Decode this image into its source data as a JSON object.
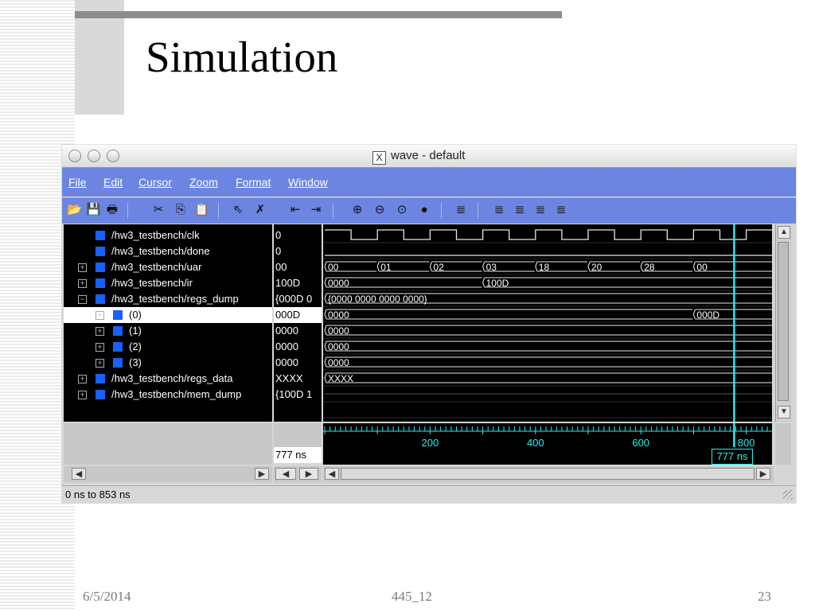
{
  "slide": {
    "title": "Simulation",
    "footer_date": "6/5/2014",
    "footer_course": "445_12",
    "footer_page": "23"
  },
  "window": {
    "title": "wave - default",
    "menu": [
      "File",
      "Edit",
      "Cursor",
      "Zoom",
      "Format",
      "Window"
    ],
    "toolbar_icons": [
      "open-icon",
      "save-icon",
      "print-icon",
      "cut-icon",
      "copy-icon",
      "paste-icon",
      "select-pointer-icon",
      "delete-icon",
      "find-previous-icon",
      "find-next-icon",
      "zoom-in-icon",
      "zoom-out-icon",
      "zoom-full-icon",
      "zoom-area-icon",
      "insert-cursor-icon",
      "insert-marker-icon",
      "edit-marker-icon",
      "next-edge-icon",
      "delete-cursor-icon"
    ]
  },
  "signals": [
    {
      "name": "/hw3_testbench/clk",
      "value": "0",
      "expandable": false,
      "indent": 0
    },
    {
      "name": "/hw3_testbench/done",
      "value": "0",
      "expandable": false,
      "indent": 0
    },
    {
      "name": "/hw3_testbench/uar",
      "value": "00",
      "expandable": true,
      "indent": 0
    },
    {
      "name": "/hw3_testbench/ir",
      "value": "100D",
      "expandable": true,
      "indent": 0
    },
    {
      "name": "/hw3_testbench/regs_dump",
      "value": "{000D 0",
      "expandable": true,
      "expanded": true,
      "indent": 0
    },
    {
      "name": "(0)",
      "value": "000D",
      "expandable": true,
      "indent": 1,
      "selected": true
    },
    {
      "name": "(1)",
      "value": "0000",
      "expandable": true,
      "indent": 1
    },
    {
      "name": "(2)",
      "value": "0000",
      "expandable": true,
      "indent": 1
    },
    {
      "name": "(3)",
      "value": "0000",
      "expandable": true,
      "indent": 1
    },
    {
      "name": "/hw3_testbench/regs_data",
      "value": "XXXX",
      "expandable": true,
      "indent": 0
    },
    {
      "name": "/hw3_testbench/mem_dump",
      "value": "{100D 1",
      "expandable": true,
      "indent": 0
    }
  ],
  "waveform": {
    "time_end_ns": 853,
    "clk_half_period_ns": 50,
    "uar_values": [
      {
        "t": 0,
        "v": "00"
      },
      {
        "t": 100,
        "v": "01"
      },
      {
        "t": 200,
        "v": "02"
      },
      {
        "t": 300,
        "v": "03"
      },
      {
        "t": 400,
        "v": "18"
      },
      {
        "t": 500,
        "v": "20"
      },
      {
        "t": 600,
        "v": "28"
      },
      {
        "t": 700,
        "v": "00"
      }
    ],
    "ir_values": [
      {
        "t": 0,
        "v": "0000"
      },
      {
        "t": 300,
        "v": "100D"
      }
    ],
    "regs_dump_label": "{0000 0000 0000 0000}",
    "reg0_values": [
      {
        "t": 0,
        "v": "0000"
      },
      {
        "t": 700,
        "v": "000D"
      }
    ],
    "reg1_label": "0000",
    "reg2_label": "0000",
    "reg3_label": "0000",
    "regs_data_label": "XXXX",
    "timeline_ticks": [
      "200",
      "400",
      "600",
      "800"
    ],
    "cursor_time": "777 ns",
    "cursor_value": "777 ns"
  },
  "status": {
    "range": "0 ns to 853 ns"
  }
}
